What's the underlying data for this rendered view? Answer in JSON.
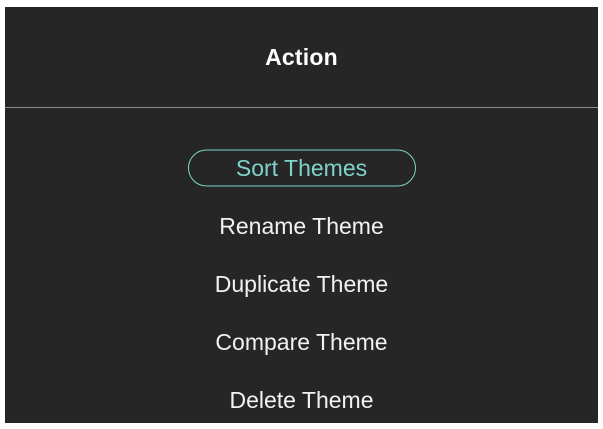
{
  "dialog": {
    "title": "Action",
    "accent_color": "#7fd3cb",
    "background_color": "#262626",
    "selected_index": 0,
    "items": [
      {
        "label": "Sort Themes"
      },
      {
        "label": "Rename Theme"
      },
      {
        "label": "Duplicate Theme"
      },
      {
        "label": "Compare Theme"
      },
      {
        "label": "Delete Theme"
      }
    ]
  }
}
